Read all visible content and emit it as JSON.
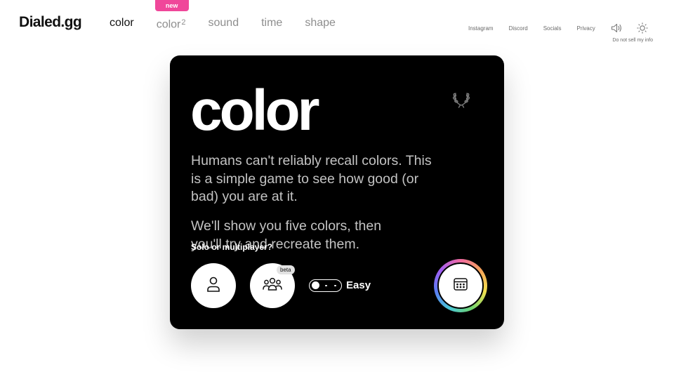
{
  "logo": "Dialed.gg",
  "nav": {
    "items": [
      {
        "label": "color",
        "active": true
      },
      {
        "label": "color",
        "sup": "2",
        "badge": "new"
      },
      {
        "label": "sound"
      },
      {
        "label": "time"
      },
      {
        "label": "shape"
      }
    ]
  },
  "top_links": [
    "Instagram",
    "Discord",
    "Socials",
    "Privacy"
  ],
  "top_icons": [
    "speaker-icon",
    "sun-icon"
  ],
  "do_not_sell": "Do not sell my info",
  "card": {
    "title": "color",
    "description": "Humans can't reliably recall colors. This is a simple game to see how good (or bad) you are at it.",
    "description2": "We'll show you five colors, then you'll try and recreate them.",
    "mode_label": "Solo or multiplayer?",
    "beta_badge": "beta",
    "difficulty": "Easy"
  },
  "colors": {
    "badge": "#f0479a",
    "card_bg": "#000000",
    "nav_inactive": "#8e8e8e",
    "desc_text": "#c3c3c3"
  }
}
